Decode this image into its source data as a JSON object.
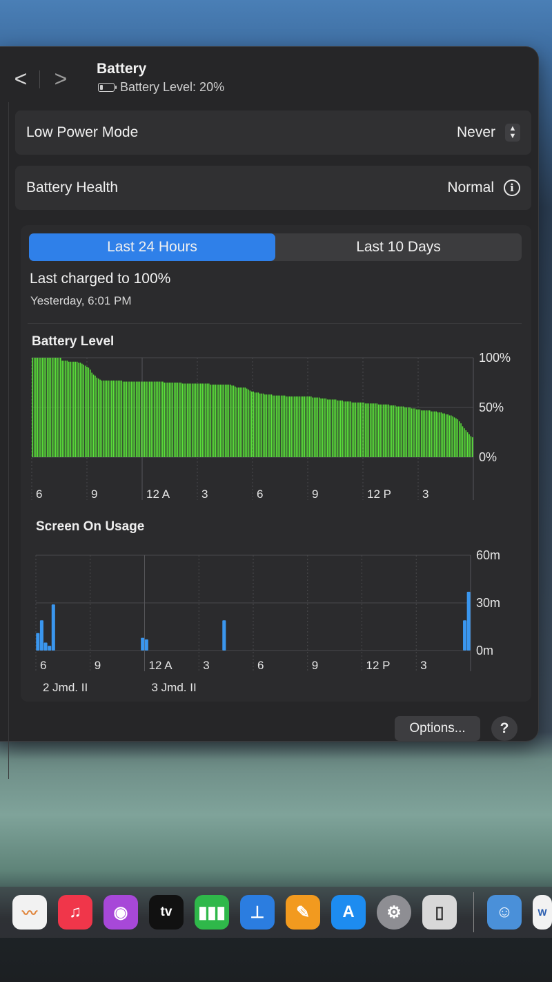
{
  "header": {
    "back": "<",
    "forward": ">",
    "title": "Battery",
    "battery_level_text": "Battery Level: 20%"
  },
  "settings": {
    "low_power_mode": {
      "label": "Low Power Mode",
      "value": "Never"
    },
    "battery_health": {
      "label": "Battery Health",
      "value": "Normal"
    }
  },
  "tabs": [
    {
      "label": "Last 24 Hours",
      "active": true
    },
    {
      "label": "Last 10 Days",
      "active": false
    }
  ],
  "last_charged": {
    "label": "Last charged to 100%",
    "time": "Yesterday, 6:01 PM"
  },
  "footer": {
    "options_label": "Options...",
    "help_label": "?"
  },
  "dock": {
    "icons": [
      "freeform-icon",
      "music-icon",
      "podcasts-icon",
      "tv-icon",
      "numbers-icon",
      "keynote-icon",
      "pages-icon",
      "app-store-icon",
      "system-settings-icon",
      "ipad-icon",
      "finder-icon",
      "word-icon"
    ],
    "tv_label": "tv"
  },
  "colors": {
    "accent": "#2f80e9",
    "battery_bar": "#5ae23a",
    "usage_bar": "#3a96ee"
  },
  "chart_data": [
    {
      "type": "bar",
      "title": "Battery Level",
      "x_tick_labels": [
        "6",
        "9",
        "12 A",
        "3",
        "6",
        "9",
        "12 P",
        "3"
      ],
      "y_tick_labels": [
        "100%",
        "50%",
        "0%"
      ],
      "ylim": [
        0,
        100
      ],
      "grid": true,
      "values": [
        100,
        100,
        100,
        100,
        100,
        100,
        100,
        100,
        100,
        100,
        100,
        100,
        100,
        100,
        100,
        100,
        100,
        100,
        97,
        97,
        97,
        97,
        96,
        96,
        96,
        96,
        96,
        96,
        95,
        95,
        94,
        93,
        92,
        91,
        90,
        88,
        85,
        83,
        82,
        80,
        79,
        78,
        77,
        77,
        77,
        77,
        77,
        77,
        77,
        77,
        77,
        77,
        77,
        77,
        77,
        76,
        76,
        76,
        76,
        76,
        76,
        76,
        76,
        76,
        76,
        76,
        76,
        76,
        76,
        76,
        76,
        76,
        76,
        76,
        76,
        76,
        76,
        76,
        76,
        76,
        75,
        75,
        75,
        75,
        75,
        75,
        75,
        75,
        75,
        75,
        75,
        74,
        74,
        74,
        74,
        74,
        74,
        74,
        74,
        74,
        74,
        74,
        74,
        74,
        74,
        74,
        74,
        74,
        73,
        73,
        73,
        73,
        73,
        73,
        73,
        73,
        73,
        73,
        73,
        73,
        73,
        72,
        72,
        71,
        70,
        70,
        70,
        70,
        70,
        70,
        69,
        68,
        67,
        66,
        66,
        65,
        65,
        65,
        64,
        64,
        64,
        63,
        63,
        63,
        63,
        63,
        62,
        62,
        62,
        62,
        62,
        62,
        62,
        62,
        61,
        61,
        61,
        61,
        61,
        61,
        61,
        61,
        61,
        61,
        61,
        61,
        61,
        61,
        61,
        61,
        60,
        60,
        60,
        60,
        60,
        59,
        59,
        59,
        59,
        58,
        58,
        58,
        58,
        58,
        58,
        57,
        57,
        57,
        57,
        56,
        56,
        56,
        56,
        56,
        55,
        55,
        55,
        55,
        55,
        55,
        55,
        55,
        54,
        54,
        54,
        54,
        54,
        54,
        54,
        54,
        53,
        53,
        53,
        53,
        53,
        53,
        53,
        52,
        52,
        52,
        52,
        51,
        51,
        51,
        51,
        51,
        50,
        50,
        50,
        50,
        49,
        49,
        49,
        48,
        48,
        48,
        47,
        47,
        47,
        47,
        47,
        47,
        46,
        46,
        46,
        46,
        45,
        45,
        45,
        44,
        44,
        43,
        43,
        42,
        42,
        41,
        40,
        39,
        38,
        36,
        34,
        31,
        29,
        27,
        25,
        23,
        21,
        20
      ]
    },
    {
      "type": "bar",
      "title": "Screen On Usage",
      "x_tick_labels": [
        "6",
        "9",
        "12 A",
        "3",
        "6",
        "9",
        "12 P",
        "3"
      ],
      "x_date_labels": [
        "2 Jmd. II",
        "3 Jmd. II"
      ],
      "y_tick_labels": [
        "60m",
        "30m",
        "0m"
      ],
      "ylim": [
        0,
        60
      ],
      "unit": "minutes",
      "grid": true,
      "values": [
        11,
        19,
        5,
        3,
        29,
        0,
        0,
        0,
        0,
        0,
        0,
        0,
        0,
        0,
        0,
        0,
        0,
        0,
        0,
        0,
        0,
        0,
        0,
        0,
        0,
        0,
        0,
        8,
        7,
        0,
        0,
        0,
        0,
        0,
        0,
        0,
        0,
        0,
        0,
        0,
        0,
        0,
        0,
        0,
        0,
        0,
        0,
        0,
        19,
        0,
        0,
        0,
        0,
        0,
        0,
        0,
        0,
        0,
        0,
        0,
        0,
        0,
        0,
        0,
        0,
        0,
        0,
        0,
        0,
        0,
        0,
        0,
        0,
        0,
        0,
        0,
        0,
        0,
        0,
        0,
        0,
        0,
        0,
        0,
        0,
        0,
        0,
        0,
        0,
        0,
        0,
        0,
        0,
        0,
        0,
        0,
        0,
        0,
        0,
        0,
        0,
        0,
        0,
        0,
        0,
        0,
        0,
        0,
        0,
        0,
        19,
        37
      ]
    }
  ]
}
